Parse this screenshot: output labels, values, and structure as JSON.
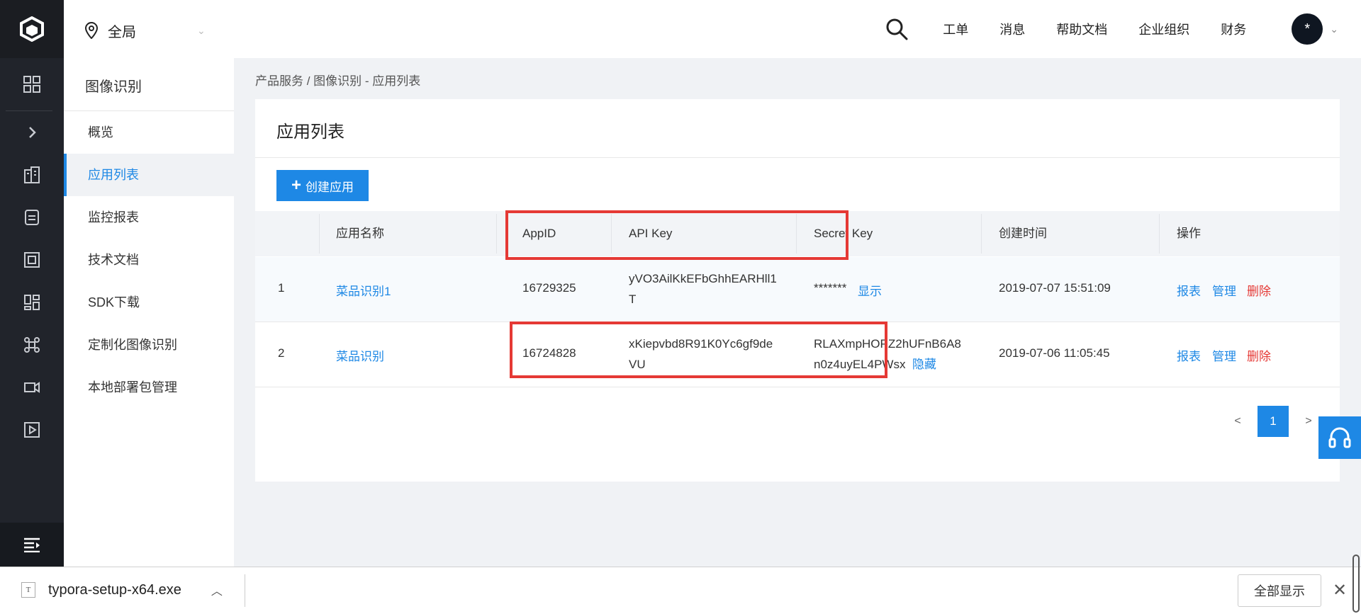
{
  "header": {
    "region": "全局",
    "nav": [
      "工单",
      "消息",
      "帮助文档",
      "企业组织",
      "财务"
    ],
    "avatar": "*"
  },
  "sidebar": {
    "title": "图像识别",
    "items": [
      {
        "label": "概览"
      },
      {
        "label": "应用列表"
      },
      {
        "label": "监控报表"
      },
      {
        "label": "技术文档"
      },
      {
        "label": "SDK下载"
      },
      {
        "label": "定制化图像识别"
      },
      {
        "label": "本地部署包管理"
      }
    ],
    "active_index": 1
  },
  "breadcrumb": "产品服务 / 图像识别 - 应用列表",
  "page": {
    "title": "应用列表",
    "create_button": "创建应用"
  },
  "table": {
    "columns": [
      "应用名称",
      "AppID",
      "API Key",
      "Secret Key",
      "创建时间",
      "操作"
    ],
    "rows": [
      {
        "index": "1",
        "name": "菜品识别1",
        "appid": "16729325",
        "api_key": "yVO3AilKkEFbGhhEARHll1T",
        "secret_key": "*******",
        "secret_toggle": "显示",
        "created": "2019-07-07 15:51:09",
        "actions": [
          "报表",
          "管理",
          "删除"
        ]
      },
      {
        "index": "2",
        "name": "菜品识别",
        "appid": "16724828",
        "api_key": "xKiepvbd8R91K0Yc6gf9deVU",
        "secret_key": "RLAXmpHOPZ2hUFnB6A8n0z4uyEL4PWsx",
        "secret_toggle": "隐藏",
        "created": "2019-07-06 11:05:45",
        "actions": [
          "报表",
          "管理",
          "删除"
        ]
      }
    ]
  },
  "pagination": {
    "prev": "<",
    "current": "1",
    "next": ">"
  },
  "download_bar": {
    "file_icon_letter": "T",
    "filename": "typora-setup-x64.exe",
    "show_all": "全部显示",
    "close": "✕"
  },
  "colors": {
    "accent": "#1e88e5",
    "danger": "#e53935",
    "sidebar_dark": "#21242b",
    "highlight_box": "#e53935"
  }
}
